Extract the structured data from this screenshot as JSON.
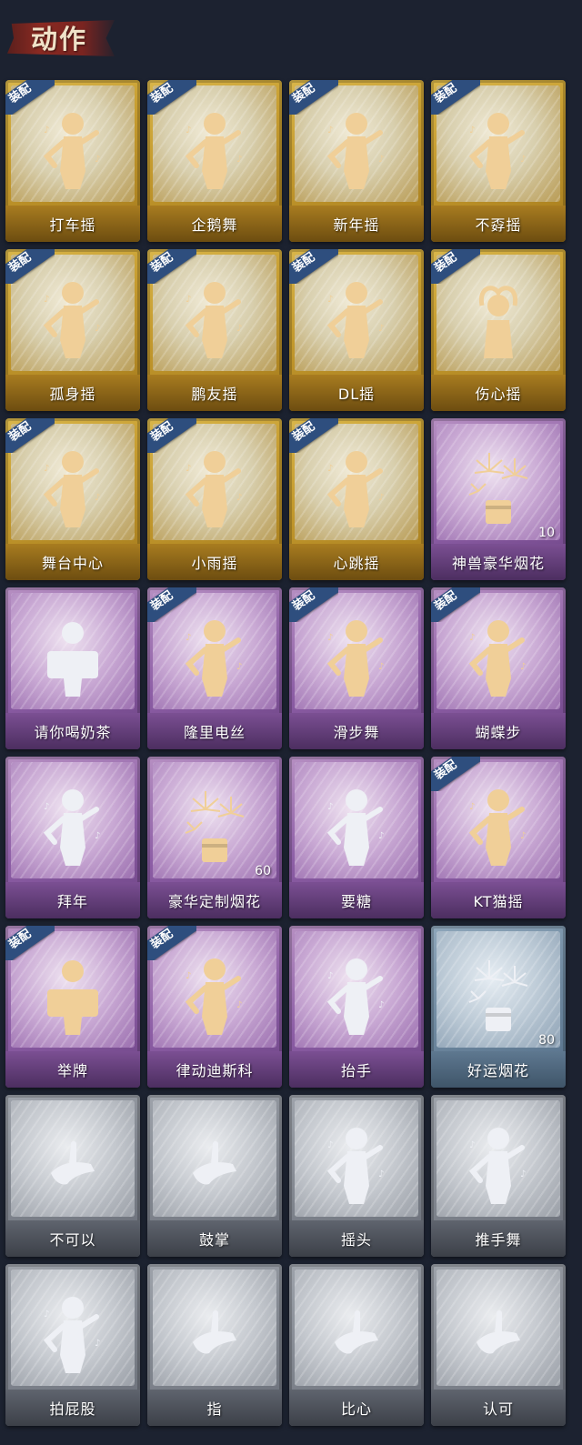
{
  "header": {
    "title": "动作"
  },
  "colors": {
    "background": "#1c2230",
    "gold": "#c59b2e",
    "purple": "#8d5ea6",
    "blue": "#6d879e",
    "gray": "#80858e",
    "badge": "#2e4e7e"
  },
  "equip_badge_label": "装配",
  "cards": [
    {
      "label": "打车摇",
      "tier": "gold",
      "equipped": true,
      "icon": "dance-pose-icon"
    },
    {
      "label": "企鹅舞",
      "tier": "gold",
      "equipped": true,
      "icon": "dance-pose-icon"
    },
    {
      "label": "新年摇",
      "tier": "gold",
      "equipped": true,
      "icon": "dance-pose-icon"
    },
    {
      "label": "不孬摇",
      "tier": "gold",
      "equipped": true,
      "icon": "dance-pose-icon"
    },
    {
      "label": "孤身摇",
      "tier": "gold",
      "equipped": true,
      "icon": "dance-pose-icon"
    },
    {
      "label": "鹏友摇",
      "tier": "gold",
      "equipped": true,
      "icon": "dance-pose-icon"
    },
    {
      "label": "DL摇",
      "tier": "gold",
      "equipped": true,
      "icon": "dance-pose-icon"
    },
    {
      "label": "伤心摇",
      "tier": "gold",
      "equipped": true,
      "icon": "heart-pose-icon"
    },
    {
      "label": "舞台中心",
      "tier": "gold",
      "equipped": true,
      "icon": "dance-pose-icon"
    },
    {
      "label": "小雨摇",
      "tier": "gold",
      "equipped": true,
      "icon": "dance-pose-icon"
    },
    {
      "label": "心跳摇",
      "tier": "gold",
      "equipped": true,
      "icon": "dance-pose-icon"
    },
    {
      "label": "神兽豪华烟花",
      "tier": "purple",
      "equipped": false,
      "icon": "fireworks-icon",
      "count": "10"
    },
    {
      "label": "请你喝奶茶",
      "tier": "purple",
      "equipped": false,
      "icon": "sign-pose-icon"
    },
    {
      "label": "隆里电丝",
      "tier": "purple",
      "equipped": true,
      "icon": "dance-pose-icon"
    },
    {
      "label": "滑步舞",
      "tier": "purple",
      "equipped": true,
      "icon": "dance-pose-icon"
    },
    {
      "label": "蝴蝶步",
      "tier": "purple",
      "equipped": true,
      "icon": "dance-pose-icon"
    },
    {
      "label": "拜年",
      "tier": "purple",
      "equipped": false,
      "icon": "bow-pose-icon"
    },
    {
      "label": "豪华定制烟花",
      "tier": "purple",
      "equipped": false,
      "icon": "fireworks-icon",
      "count": "60"
    },
    {
      "label": "要糖",
      "tier": "purple",
      "equipped": false,
      "icon": "reach-pose-icon"
    },
    {
      "label": "KT猫摇",
      "tier": "purple",
      "equipped": true,
      "icon": "dance-pose-icon"
    },
    {
      "label": "举牌",
      "tier": "purple",
      "equipped": true,
      "icon": "sign-pose-icon"
    },
    {
      "label": "律动迪斯科",
      "tier": "purple",
      "equipped": true,
      "icon": "dance-pose-icon"
    },
    {
      "label": "抬手",
      "tier": "purple",
      "equipped": false,
      "icon": "reach-pose-icon"
    },
    {
      "label": "好运烟花",
      "tier": "blue",
      "equipped": false,
      "icon": "fireworks-icon",
      "count": "80"
    },
    {
      "label": "不可以",
      "tier": "gray",
      "equipped": false,
      "icon": "finger-wag-icon"
    },
    {
      "label": "鼓掌",
      "tier": "gray",
      "equipped": false,
      "icon": "clap-icon"
    },
    {
      "label": "摇头",
      "tier": "gray",
      "equipped": false,
      "icon": "bow-pose-icon"
    },
    {
      "label": "推手舞",
      "tier": "gray",
      "equipped": false,
      "icon": "dance-pose-icon"
    },
    {
      "label": "拍屁股",
      "tier": "gray",
      "equipped": false,
      "icon": "bow-pose-icon"
    },
    {
      "label": "指",
      "tier": "gray",
      "equipped": false,
      "icon": "point-hand-icon"
    },
    {
      "label": "比心",
      "tier": "gray",
      "equipped": false,
      "icon": "finger-heart-icon"
    },
    {
      "label": "认可",
      "tier": "gray",
      "equipped": false,
      "icon": "thumbs-up-icon"
    }
  ]
}
